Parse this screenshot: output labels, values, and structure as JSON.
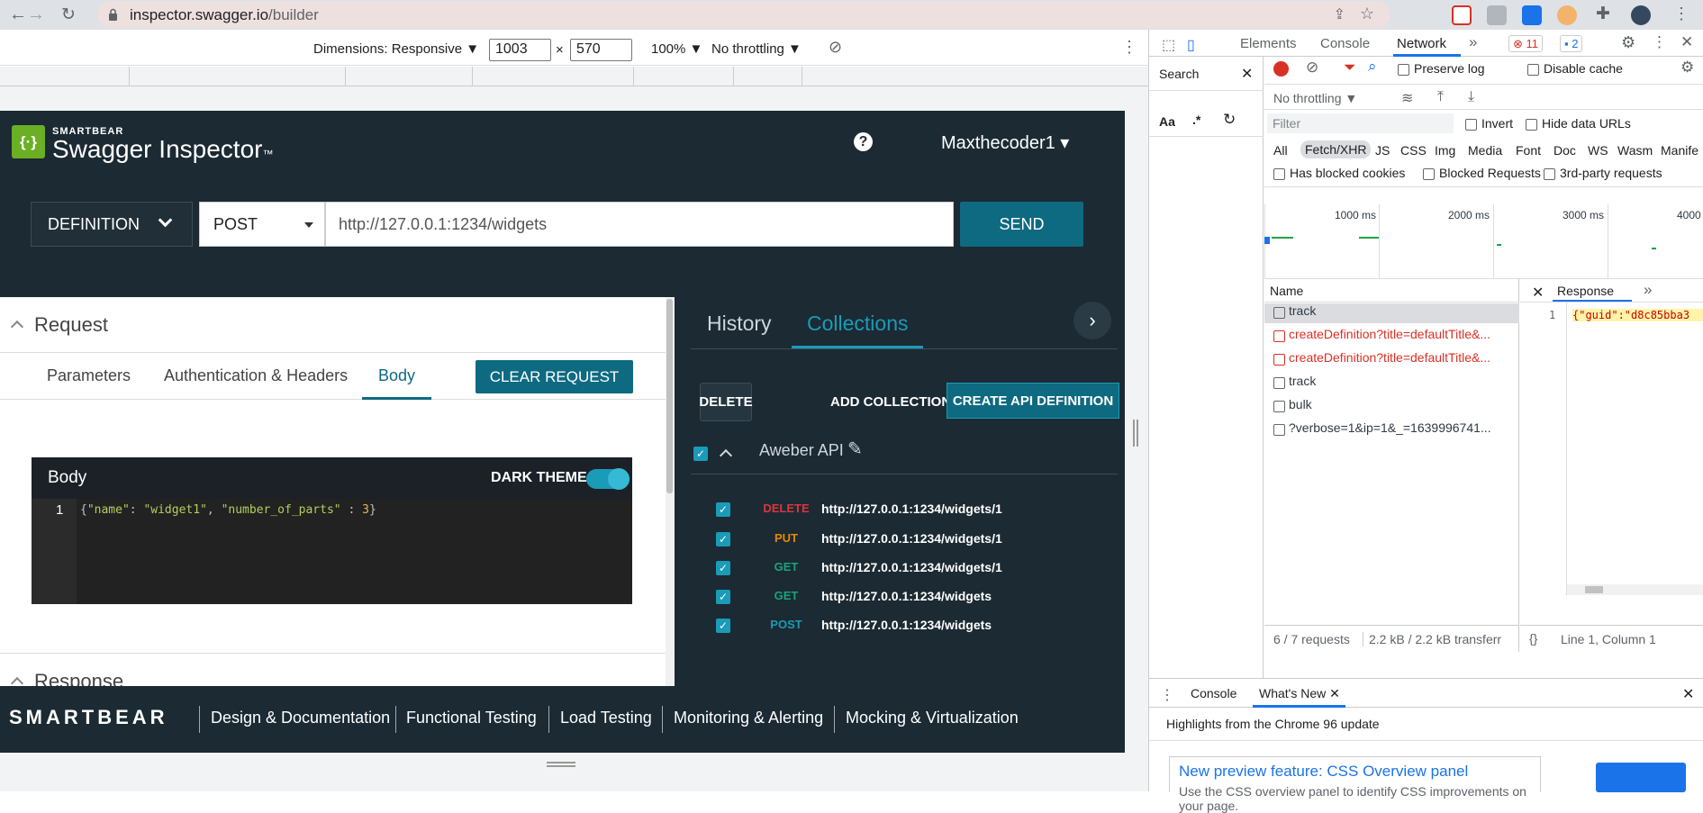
{
  "browser": {
    "url_host": "inspector.swagger.io",
    "url_path": "/builder"
  },
  "device_toolbar": {
    "dimensions_label": "Dimensions: Responsive ▼",
    "width": "1003",
    "times": "×",
    "height": "570",
    "zoom": "100% ▼",
    "throttle": "No throttling ▼"
  },
  "app": {
    "brand_small": "SMARTBEAR",
    "brand_name": "Swagger Inspector",
    "brand_tm": "™",
    "help": "?",
    "user": "Maxthecoder1 ▾",
    "definition_btn": "DEFINITION",
    "method": "POST",
    "url": "http://127.0.0.1:1234/widgets",
    "send": "SEND"
  },
  "request": {
    "title": "Request",
    "tabs": [
      "Parameters",
      "Authentication & Headers",
      "Body"
    ],
    "clear": "CLEAR REQUEST",
    "body_title": "Body",
    "dark_theme": "DARK THEME",
    "line_no": "1",
    "code_open": "{",
    "code_k1": "\"name\"",
    "code_c1": ": ",
    "code_v1": "\"widget1\"",
    "code_c2": ", ",
    "code_k2": "\"number_of_parts\"",
    "code_c3": " : ",
    "code_v2": "3",
    "code_close": "}"
  },
  "response": {
    "title": "Response"
  },
  "collections": {
    "history": "History",
    "collections": "Collections",
    "delete": "DELETE",
    "add_collection": "ADD COLLECTION",
    "create_api": "CREATE API DEFINITION",
    "api_name": "Aweber API",
    "rows": [
      {
        "method": "DELETE",
        "url": "http://127.0.0.1:1234/widgets/1",
        "color": "#d9363e"
      },
      {
        "method": "PUT",
        "url": "http://127.0.0.1:1234/widgets/1",
        "color": "#e68a00"
      },
      {
        "method": "GET",
        "url": "http://127.0.0.1:1234/widgets/1",
        "color": "#1aa37a"
      },
      {
        "method": "GET",
        "url": "http://127.0.0.1:1234/widgets",
        "color": "#1aa37a"
      },
      {
        "method": "POST",
        "url": "http://127.0.0.1:1234/widgets",
        "color": "#1a9bb8"
      }
    ]
  },
  "footer": {
    "brand": "SMARTBEAR",
    "links": [
      "Design & Documentation",
      "Functional Testing",
      "Load Testing",
      "Monitoring & Alerting",
      "Mocking & Virtualization"
    ]
  },
  "devtools": {
    "tabs": [
      "Elements",
      "Console",
      "Network"
    ],
    "more": "»",
    "errors": "11",
    "messages": "2",
    "search_tab": "Search",
    "aa": "Aa",
    "regex": ".*",
    "preserve_log": "Preserve log",
    "disable_cache": "Disable cache",
    "no_throttling": "No throttling",
    "filter_placeholder": "Filter",
    "invert": "Invert",
    "hide_data_urls": "Hide data URLs",
    "types": [
      "All",
      "Fetch/XHR",
      "JS",
      "CSS",
      "Img",
      "Media",
      "Font",
      "Doc",
      "WS",
      "Wasm",
      "Manife"
    ],
    "has_blocked": "Has blocked cookies",
    "blocked_requests": "Blocked Requests",
    "third_party": "3rd-party requests",
    "timeline_labels": [
      "1000 ms",
      "2000 ms",
      "3000 ms",
      "4000"
    ],
    "name_header": "Name",
    "requests": [
      {
        "name": "track",
        "error": false
      },
      {
        "name": "createDefinition?title=defaultTitle&...",
        "error": true
      },
      {
        "name": "createDefinition?title=defaultTitle&...",
        "error": true
      },
      {
        "name": "track",
        "error": false
      },
      {
        "name": "bulk",
        "error": false
      },
      {
        "name": "?verbose=1&ip=1&_=1639996741...",
        "error": false
      }
    ],
    "response_tab": "Response",
    "response_line": "1",
    "response_text": "{\"guid\":\"d8c85bba3",
    "status_requests": "6 / 7 requests",
    "status_transfer": "2.2 kB / 2.2 kB transferr",
    "cursor": "Line 1, Column 1",
    "drawer_console": "Console",
    "drawer_whatsnew": "What's New",
    "highlights": "Highlights from the Chrome 96 update",
    "card_title": "New preview feature: CSS Overview panel",
    "card_text": "Use the CSS overview panel to identify CSS improvements on your page."
  }
}
